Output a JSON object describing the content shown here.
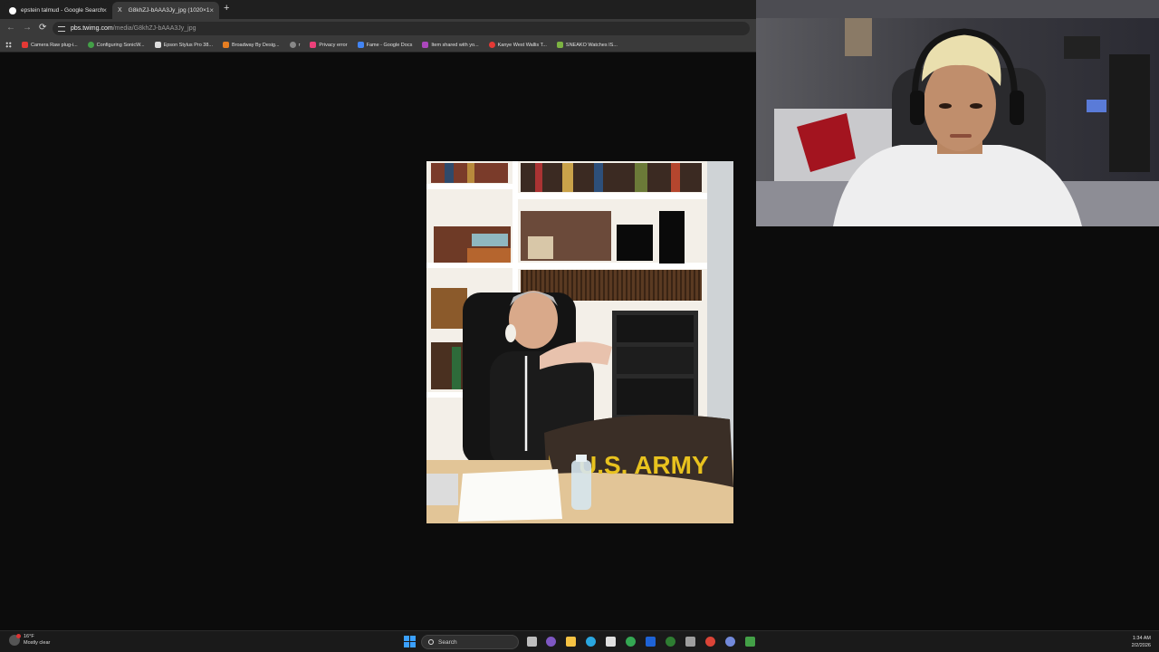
{
  "browser": {
    "tabs": [
      {
        "title": "epstein talmud - Google Search",
        "active": false,
        "close": "×"
      },
      {
        "title": "G8khZJ-bAAA3Jy_jpg (1020×1",
        "active": true,
        "close": "×"
      }
    ],
    "new_tab": "+",
    "nav": {
      "back": "←",
      "forward": "→",
      "reload": "⟳"
    },
    "address": {
      "host": "pbs.twimg.com",
      "path": "/media/G8khZJ-bAAA3Jy_jpg"
    },
    "bookmarks": [
      {
        "label": "Camera Raw plug-i...",
        "icon_color": "#e53935",
        "icon": "adobe-icon"
      },
      {
        "label": "Configuring SonicW...",
        "icon_color": "#43a047",
        "icon": "sonicwall-icon"
      },
      {
        "label": "Epson Stylus Pro 38...",
        "icon_color": "#dddddd",
        "icon": "epson-icon"
      },
      {
        "label": "Broadway By Desig...",
        "icon_color": "#e67e22",
        "icon": "broadway-icon"
      },
      {
        "label": "r",
        "icon_color": "#888888",
        "icon": "globe-icon"
      },
      {
        "label": "Privacy error",
        "icon_color": "#ec407a",
        "icon": "warning-icon"
      },
      {
        "label": "Fame - Google Docs",
        "icon_color": "#4285f4",
        "icon": "docs-icon"
      },
      {
        "label": "Item shared with yo...",
        "icon_color": "#ab47bc",
        "icon": "shared-icon"
      },
      {
        "label": "Kanye West Wallis T...",
        "icon_color": "#e53935",
        "icon": "youtube-icon"
      },
      {
        "label": "SNEAKO Watches IS...",
        "icon_color": "#7cb342",
        "icon": "rumble-icon"
      }
    ]
  },
  "photo": {
    "caption_text": "U.S. ARMY"
  },
  "taskbar": {
    "weather": {
      "temp": "16°F",
      "condition": "Mostly clear"
    },
    "search_placeholder": "Search",
    "clock": {
      "time": "1:34 AM",
      "date": "2/2/2026"
    },
    "pinned": [
      {
        "name": "file-icon",
        "color": "#bdbdbd"
      },
      {
        "name": "copilot-icon",
        "color": "#7e57c2"
      },
      {
        "name": "folder-icon",
        "color": "#f6c343"
      },
      {
        "name": "edge-icon",
        "color": "#2aa7e0"
      },
      {
        "name": "store-icon",
        "color": "#e0e0e0"
      },
      {
        "name": "chrome-icon",
        "color": "#34a853"
      },
      {
        "name": "app-blue-icon",
        "color": "#1e63d6"
      },
      {
        "name": "xbox-icon",
        "color": "#2e7d32"
      },
      {
        "name": "app-gray-icon",
        "color": "#9e9e9e"
      },
      {
        "name": "chrome-alt-icon",
        "color": "#db4437"
      },
      {
        "name": "discord-icon",
        "color": "#7289da"
      },
      {
        "name": "app-green-icon",
        "color": "#43a047"
      }
    ]
  }
}
